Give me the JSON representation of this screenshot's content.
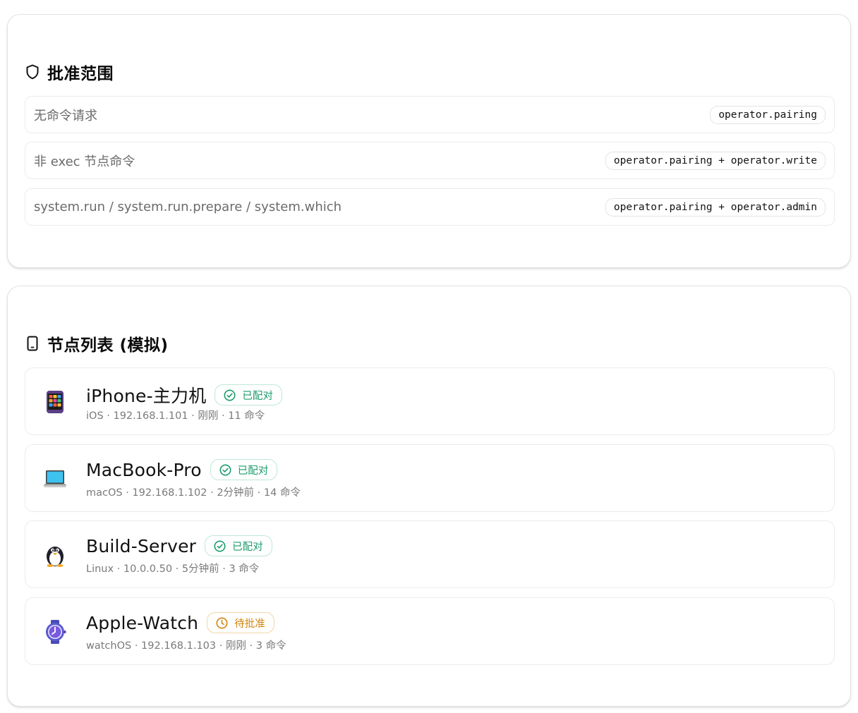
{
  "scope_section": {
    "title": "批准范围",
    "icon": "shield-icon",
    "rows": [
      {
        "label": "无命令请求",
        "scope": "operator.pairing"
      },
      {
        "label": "非 exec 节点命令",
        "scope": "operator.pairing + operator.write"
      },
      {
        "label": "system.run / system.run.prepare / system.which",
        "scope": "operator.pairing + operator.admin"
      }
    ]
  },
  "nodes_section": {
    "title": "节点列表 (模拟)",
    "icon": "phone-outline-icon",
    "nodes": [
      {
        "name": "iPhone-主力机",
        "icon": "mobile-phone-icon",
        "status": "已配对",
        "status_type": "paired",
        "meta": "iOS · 192.168.1.101 · 刚刚 · 11 命令"
      },
      {
        "name": "MacBook-Pro",
        "icon": "laptop-icon",
        "status": "已配对",
        "status_type": "paired",
        "meta": "macOS · 192.168.1.102 · 2分钟前 · 14 命令"
      },
      {
        "name": "Build-Server",
        "icon": "penguin-icon",
        "status": "已配对",
        "status_type": "paired",
        "meta": "Linux · 10.0.0.50 · 5分钟前 · 3 命令"
      },
      {
        "name": "Apple-Watch",
        "icon": "watch-icon",
        "status": "待批准",
        "status_type": "pending",
        "meta": "watchOS · 192.168.1.103 · 刚刚 · 3 命令"
      }
    ]
  },
  "colors": {
    "paired": "#1a9c6b",
    "pending": "#d4850c"
  }
}
